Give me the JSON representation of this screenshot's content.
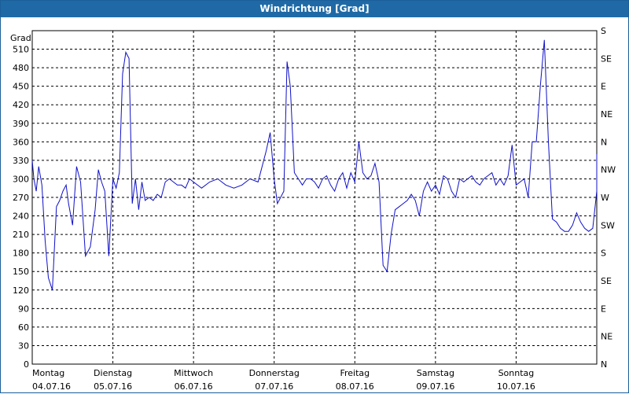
{
  "window": {
    "title": "Windrichtung [Grad]"
  },
  "chart_data": {
    "type": "line",
    "title": "Windrichtung [Grad]",
    "ylabel": "Grad",
    "ylim": [
      0,
      540
    ],
    "y_ticks": [
      0,
      30,
      60,
      90,
      120,
      150,
      180,
      210,
      240,
      270,
      300,
      330,
      360,
      390,
      420,
      450,
      480,
      510
    ],
    "right_axis_labels": [
      "N",
      "NE",
      "E",
      "SE",
      "S",
      "SW",
      "W",
      "NW",
      "N",
      "NE",
      "E",
      "SE",
      "S"
    ],
    "x_axis_labels": [
      {
        "day": "Montag",
        "date": "04.07.16"
      },
      {
        "day": "Dienstag",
        "date": "05.07.16"
      },
      {
        "day": "Mittwoch",
        "date": "06.07.16"
      },
      {
        "day": "Donnerstag",
        "date": "07.07.16"
      },
      {
        "day": "Freitag",
        "date": "08.07.16"
      },
      {
        "day": "Samstag",
        "date": "09.07.16"
      },
      {
        "day": "Sonntag",
        "date": "10.07.16"
      }
    ],
    "grid": true,
    "line_color": "#1010c8",
    "series": [
      {
        "x": [
          0,
          0.02,
          0.05,
          0.08,
          0.12,
          0.16,
          0.2,
          0.25,
          0.3,
          0.34,
          0.38,
          0.42,
          0.45,
          0.5,
          0.55,
          0.6,
          0.66,
          0.72,
          0.78,
          0.82,
          0.86,
          0.9,
          0.95,
          1.0,
          1.04,
          1.08,
          1.12,
          1.16,
          1.2,
          1.24,
          1.28,
          1.32,
          1.36,
          1.4,
          1.45,
          1.5,
          1.55,
          1.6,
          1.65,
          1.7,
          1.75,
          1.8,
          1.85,
          1.9,
          1.95,
          2.0,
          2.1,
          2.2,
          2.3,
          2.4,
          2.5,
          2.6,
          2.7,
          2.8,
          2.9,
          2.95,
          3.0,
          3.04,
          3.08,
          3.12,
          3.16,
          3.2,
          3.25,
          3.3,
          3.35,
          3.4,
          3.45,
          3.5,
          3.55,
          3.6,
          3.65,
          3.7,
          3.75,
          3.8,
          3.85,
          3.9,
          3.95,
          4.0,
          4.05,
          4.1,
          4.15,
          4.2,
          4.25,
          4.3,
          4.35,
          4.4,
          4.45,
          4.5,
          4.55,
          4.6,
          4.65,
          4.7,
          4.75,
          4.8,
          4.85,
          4.9,
          4.95,
          5.0,
          5.05,
          5.1,
          5.15,
          5.2,
          5.25,
          5.3,
          5.35,
          5.4,
          5.45,
          5.5,
          5.55,
          5.6,
          5.65,
          5.7,
          5.75,
          5.8,
          5.85,
          5.9,
          5.95,
          6.0,
          6.05,
          6.1,
          6.15,
          6.2,
          6.25,
          6.3,
          6.35,
          6.4,
          6.45,
          6.5,
          6.55,
          6.6,
          6.65,
          6.7,
          6.75,
          6.8,
          6.85,
          6.9,
          6.95,
          7.0,
          7.05,
          7.1,
          7.15
        ],
        "y": [
          330,
          300,
          280,
          320,
          290,
          200,
          140,
          120,
          255,
          265,
          280,
          290,
          260,
          225,
          320,
          295,
          175,
          190,
          250,
          315,
          295,
          280,
          175,
          300,
          285,
          310,
          470,
          505,
          495,
          260,
          300,
          250,
          295,
          265,
          270,
          265,
          275,
          270,
          295,
          300,
          295,
          290,
          290,
          285,
          300,
          295,
          285,
          295,
          300,
          290,
          285,
          290,
          300,
          295,
          345,
          375,
          300,
          260,
          270,
          280,
          490,
          450,
          310,
          300,
          290,
          300,
          300,
          295,
          285,
          300,
          305,
          290,
          280,
          300,
          310,
          285,
          310,
          295,
          360,
          310,
          300,
          305,
          325,
          295,
          160,
          150,
          210,
          250,
          255,
          260,
          265,
          275,
          265,
          240,
          280,
          295,
          280,
          290,
          275,
          305,
          300,
          280,
          270,
          300,
          295,
          300,
          305,
          295,
          290,
          300,
          305,
          310,
          290,
          300,
          290,
          305,
          355,
          290,
          295,
          300,
          270,
          360,
          360,
          450,
          525,
          360,
          235,
          230,
          220,
          215,
          215,
          225,
          245,
          230,
          220,
          215,
          220,
          280,
          300,
          340,
          285
        ]
      }
    ]
  }
}
